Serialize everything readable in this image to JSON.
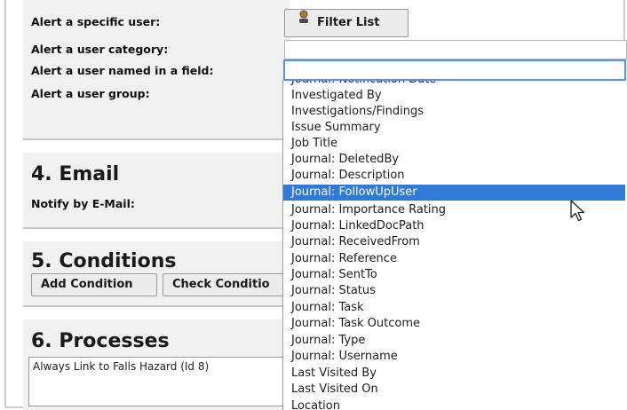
{
  "recipients": {
    "specific_user_label": "Alert a specific user:",
    "category_label": "Alert a user category:",
    "named_in_field_label": "Alert a user named in a field:",
    "group_label": "Alert a user group:",
    "filter_button_label": "Filter List",
    "filter_button_icon": "user-icon"
  },
  "email_section": {
    "title": "4. Email",
    "notify_label": "Notify by E-Mail:"
  },
  "conditions_section": {
    "title": "5. Conditions",
    "add_button": "Add Condition",
    "check_button": "Check Conditio"
  },
  "processes_section": {
    "title": "6. Processes",
    "value": "Always Link to Falls Hazard (Id 8)"
  },
  "field_dropdown": {
    "partial_top": "Journal: Notification Date",
    "options": [
      "Investigated By",
      "Investigations/Findings",
      "Issue Summary",
      "Job Title",
      "Journal: DeletedBy",
      "Journal: Description",
      "Journal: FollowUpUser",
      "Journal: Importance Rating",
      "Journal: LinkedDocPath",
      "Journal: ReceivedFrom",
      "Journal: Reference",
      "Journal: SentTo",
      "Journal: Status",
      "Journal: Task",
      "Journal: Task Outcome",
      "Journal: Type",
      "Journal: Username",
      "Last Visited By",
      "Last Visited On",
      "Location"
    ],
    "selected_option": "Journal: FollowUpUser",
    "highlight_color": "#3079d6"
  }
}
